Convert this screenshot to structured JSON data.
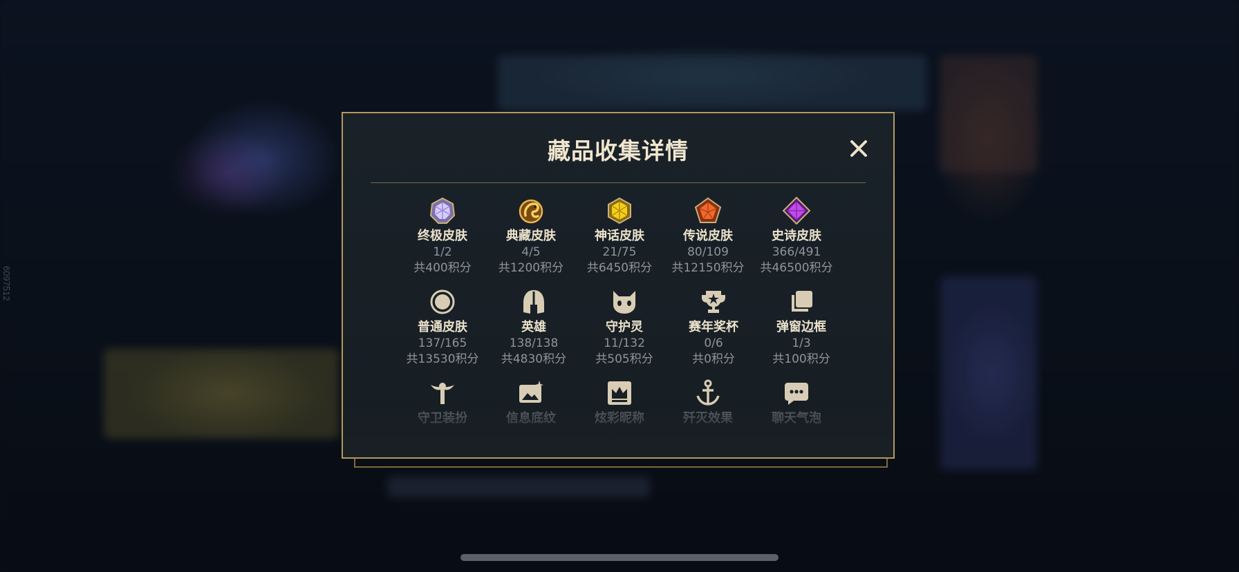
{
  "side_label": "6097512",
  "modal": {
    "title": "藏品收集详情",
    "close_icon": "close-icon",
    "accent_color": "#b69a5c"
  },
  "collections": [
    {
      "name": "终极皮肤",
      "count": "1/2",
      "points": "共400积分",
      "icon": "ultimate-skin-gem-icon",
      "color": "#c8b8f0"
    },
    {
      "name": "典藏皮肤",
      "count": "4/5",
      "points": "共1200积分",
      "icon": "prestige-dragon-emblem-icon",
      "color": "#d9a441"
    },
    {
      "name": "神话皮肤",
      "count": "21/75",
      "points": "共6450积分",
      "icon": "mythic-skin-gem-icon",
      "color": "#e8c21a"
    },
    {
      "name": "传说皮肤",
      "count": "80/109",
      "points": "共12150积分",
      "icon": "legendary-skin-gem-icon",
      "color": "#e0602a"
    },
    {
      "name": "史诗皮肤",
      "count": "366/491",
      "points": "共46500积分",
      "icon": "epic-skin-gem-icon",
      "color": "#b040d8"
    },
    {
      "name": "普通皮肤",
      "count": "137/165",
      "points": "共13530积分",
      "icon": "normal-skin-circle-icon",
      "color": "#d8cdb4"
    },
    {
      "name": "英雄",
      "count": "138/138",
      "points": "共4830积分",
      "icon": "champion-helmet-icon",
      "color": "#d8cdb4"
    },
    {
      "name": "守护灵",
      "count": "11/132",
      "points": "共505积分",
      "icon": "guardian-pet-icon",
      "color": "#d8cdb4"
    },
    {
      "name": "赛年奖杯",
      "count": "0/6",
      "points": "共0积分",
      "icon": "season-trophy-icon",
      "color": "#d8cdb4"
    },
    {
      "name": "弹窗边框",
      "count": "1/3",
      "points": "共100积分",
      "icon": "popup-frame-icon",
      "color": "#d8cdb4"
    },
    {
      "name": "守卫装扮",
      "icon": "ward-skin-icon",
      "color": "#d8cdb4"
    },
    {
      "name": "信息底纹",
      "icon": "info-card-icon",
      "color": "#d8cdb4"
    },
    {
      "name": "炫彩昵称",
      "icon": "colorful-nickname-crown-icon",
      "color": "#d8cdb4"
    },
    {
      "name": "歼灭效果",
      "icon": "annihilation-effect-anchor-icon",
      "color": "#d8cdb4"
    },
    {
      "name": "聊天气泡",
      "icon": "chat-bubble-icon",
      "color": "#d8cdb4"
    }
  ]
}
